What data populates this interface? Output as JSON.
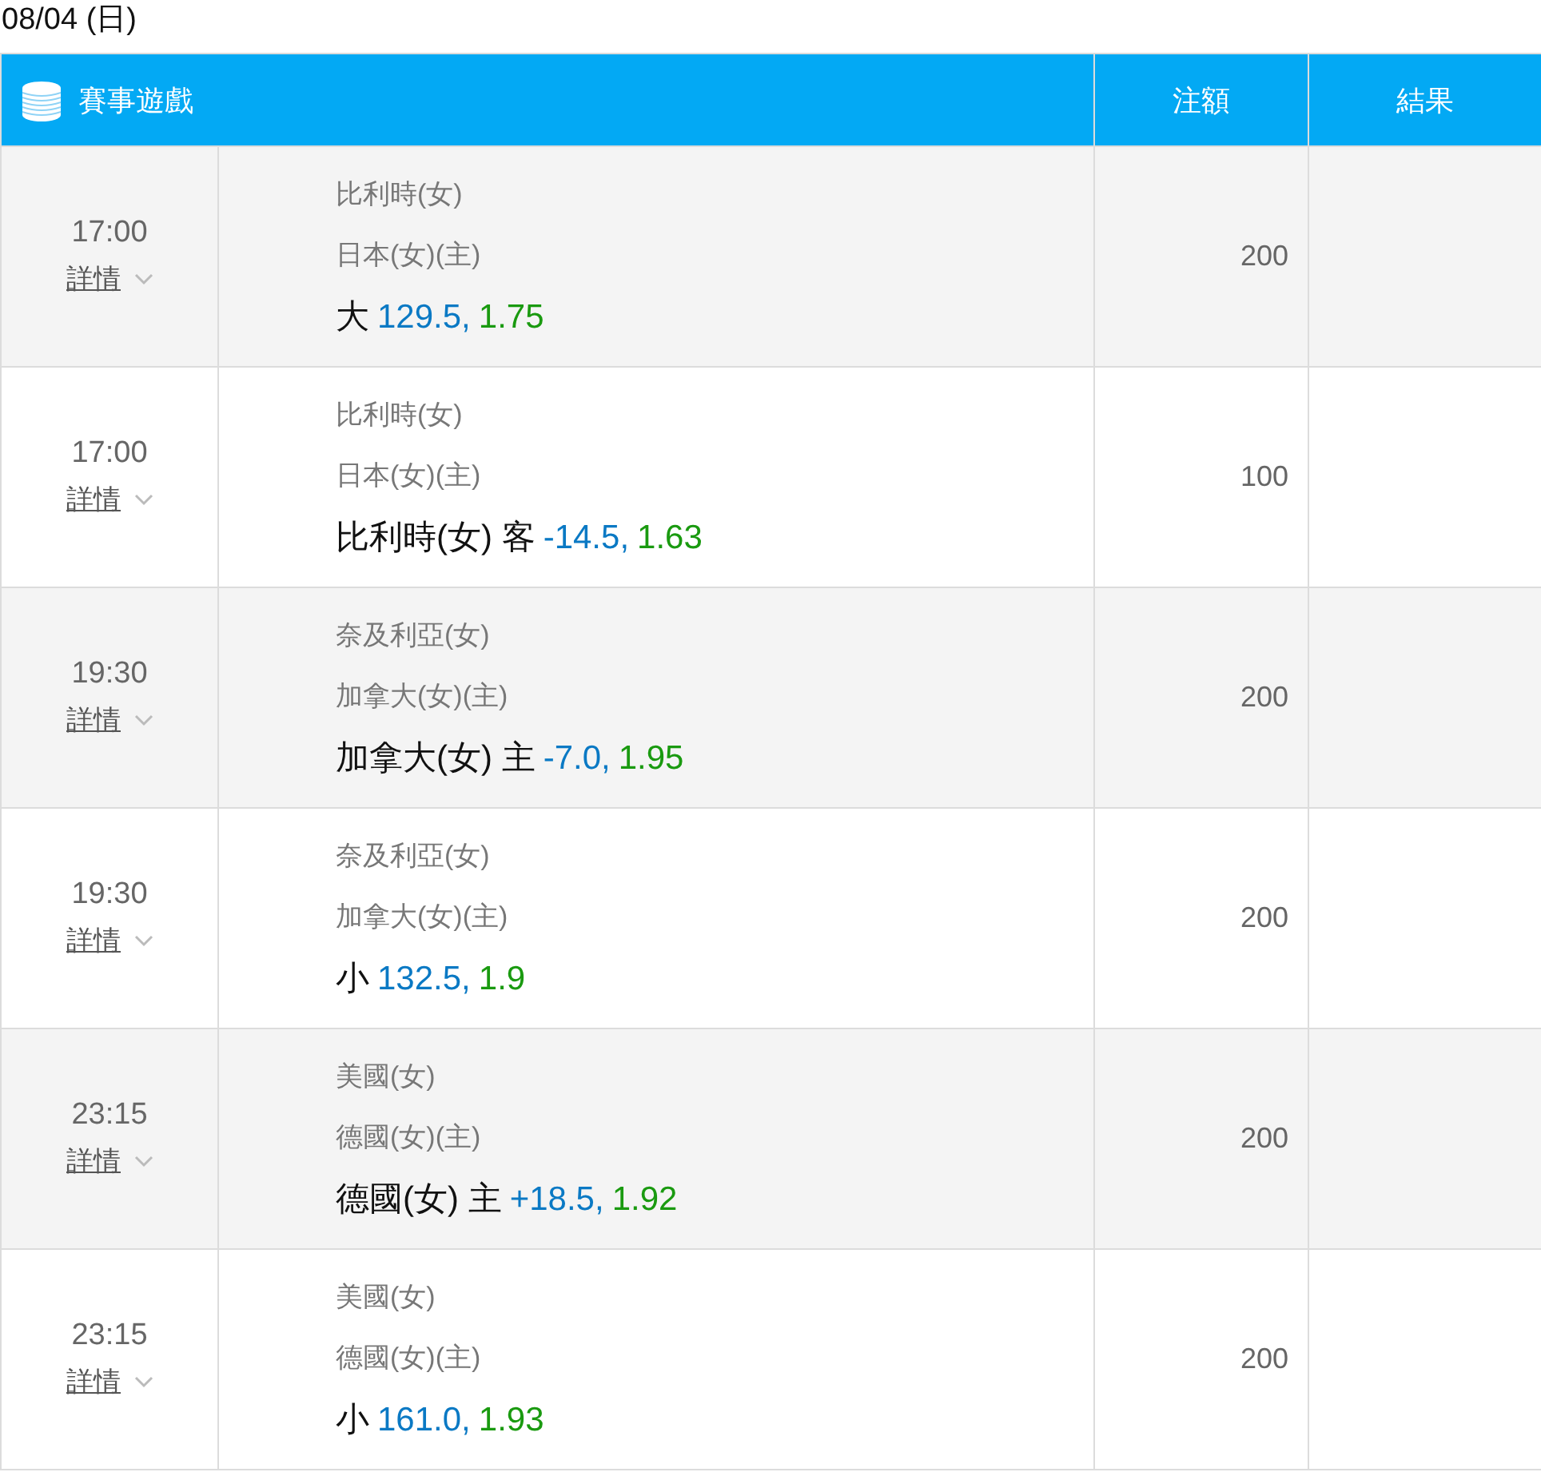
{
  "date": "08/04 (日)",
  "header": {
    "game": "賽事遊戲",
    "stake": "注額",
    "result": "結果"
  },
  "rows": [
    {
      "time": "17:00",
      "details": "詳情",
      "team_away": "比利時(女)",
      "team_home": "日本(女)(主)",
      "pick": "大",
      "line": "129.5,",
      "odds": "1.75",
      "stake": "200"
    },
    {
      "time": "17:00",
      "details": "詳情",
      "team_away": "比利時(女)",
      "team_home": "日本(女)(主)",
      "pick": "比利時(女) 客",
      "line": "-14.5,",
      "odds": "1.63",
      "stake": "100"
    },
    {
      "time": "19:30",
      "details": "詳情",
      "team_away": "奈及利亞(女)",
      "team_home": "加拿大(女)(主)",
      "pick": "加拿大(女) 主",
      "line": "-7.0,",
      "odds": "1.95",
      "stake": "200"
    },
    {
      "time": "19:30",
      "details": "詳情",
      "team_away": "奈及利亞(女)",
      "team_home": "加拿大(女)(主)",
      "pick": "小",
      "line": "132.5,",
      "odds": "1.9",
      "stake": "200"
    },
    {
      "time": "23:15",
      "details": "詳情",
      "team_away": "美國(女)",
      "team_home": "德國(女)(主)",
      "pick": "德國(女) 主",
      "line": "+18.5,",
      "odds": "1.92",
      "stake": "200"
    },
    {
      "time": "23:15",
      "details": "詳情",
      "team_away": "美國(女)",
      "team_home": "德國(女)(主)",
      "pick": "小",
      "line": "161.0,",
      "odds": "1.93",
      "stake": "200"
    }
  ]
}
